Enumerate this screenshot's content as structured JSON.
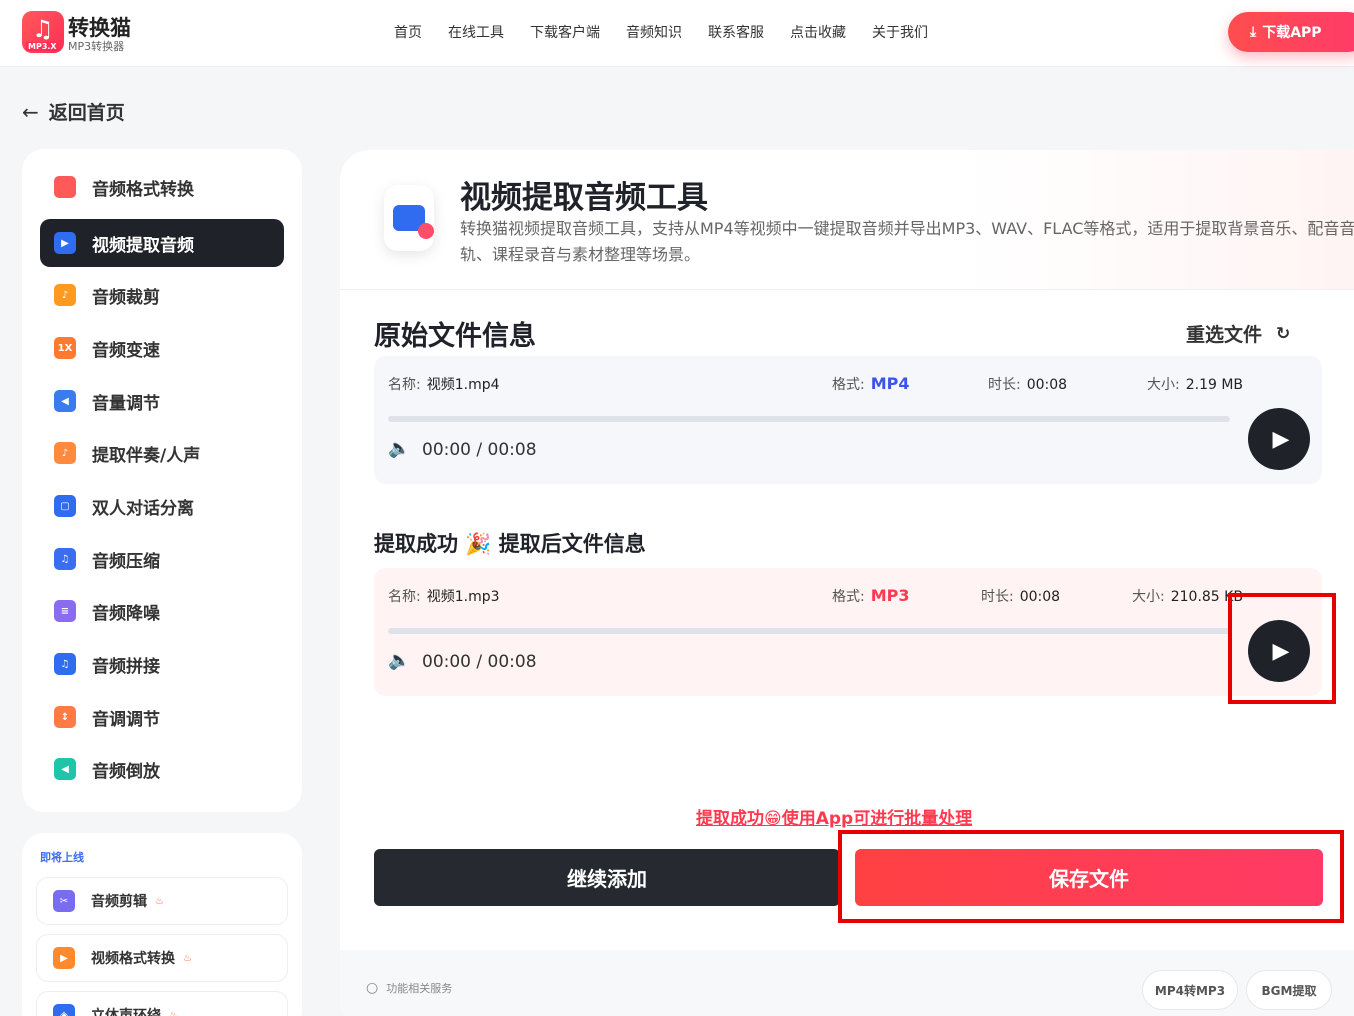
{
  "header": {
    "logo_name": "转换猫",
    "logo_sub": "MP3转换器",
    "logo_tag": "MP3.X",
    "nav": [
      "首页",
      "在线工具",
      "下载客户端",
      "音频知识",
      "联系客服",
      "点击收藏",
      "关于我们"
    ],
    "download_button": "下载APP"
  },
  "back_label": "返回首页",
  "sidebar": {
    "items": [
      {
        "label": "音频格式转换",
        "icon": "audio-convert-icon",
        "color": "#ff5a5a"
      },
      {
        "label": "视频提取音频",
        "icon": "video-audio-icon",
        "color": "#2f6cf0",
        "active": true
      },
      {
        "label": "音频裁剪",
        "icon": "crop-icon",
        "color": "#ff9a1f"
      },
      {
        "label": "音频变速",
        "icon": "speed-icon",
        "color": "#ff7a2e",
        "glyph": "1X"
      },
      {
        "label": "音量调节",
        "icon": "volume-icon",
        "color": "#3a7bf0"
      },
      {
        "label": "提取伴奏/人声",
        "icon": "vocal-icon",
        "color": "#ff8a3d"
      },
      {
        "label": "双人对话分离",
        "icon": "dialog-icon",
        "color": "#2f6cf0"
      },
      {
        "label": "音频压缩",
        "icon": "compress-icon",
        "color": "#3a6df0"
      },
      {
        "label": "音频降噪",
        "icon": "denoise-icon",
        "color": "#8a6cf0"
      },
      {
        "label": "音频拼接",
        "icon": "merge-icon",
        "color": "#2f6cf0"
      },
      {
        "label": "音调调节",
        "icon": "pitch-icon",
        "color": "#ff7a45"
      },
      {
        "label": "音频倒放",
        "icon": "reverse-icon",
        "color": "#1fc5a8"
      }
    ]
  },
  "soon": {
    "title": "即将上线",
    "items": [
      {
        "label": "音频剪辑",
        "icon": "scissors-icon",
        "color": "#7a6cf0"
      },
      {
        "label": "视频格式转换",
        "icon": "video-convert-icon",
        "color": "#ff8a2e"
      },
      {
        "label": "立体声环绕",
        "icon": "surround-icon",
        "color": "#2f6cf0"
      }
    ]
  },
  "tool": {
    "title": "视频提取音频工具",
    "description": "转换猫视频提取音频工具，支持从MP4等视频中一键提取音频并导出MP3、WAV、FLAC等格式，适用于提取背景音乐、配音音轨、课程录音与素材整理等场景。"
  },
  "original": {
    "section_title": "原始文件信息",
    "reselect": "重选文件",
    "name_label": "名称:",
    "name": "视频1.mp4",
    "format_label": "格式:",
    "format": "MP4",
    "format_color": "#3a56e6",
    "duration_label": "时长:",
    "duration": "00:08",
    "size_label": "大小:",
    "size": "2.19 MB",
    "time": "00:00 / 00:08",
    "progress": 0
  },
  "output": {
    "section_title": "提取成功 🎉 提取后文件信息",
    "name_label": "名称:",
    "name": "视频1.mp3",
    "format_label": "格式:",
    "format": "MP3",
    "format_color": "#ff3a4f",
    "duration_label": "时长:",
    "duration": "00:08",
    "size_label": "大小:",
    "size": "210.85 KB",
    "time": "00:00 / 00:08",
    "progress": 0
  },
  "promo": "提取成功😁使用App可进行批量处理",
  "actions": {
    "continue": "继续添加",
    "save": "保存文件"
  },
  "footer": {
    "services_label": "功能相关服务",
    "chips": [
      "MP4转MP3",
      "BGM提取"
    ]
  },
  "colors": {
    "accent": "#ff3a4f",
    "dark": "#1f2329",
    "highlight": "#e60000"
  }
}
